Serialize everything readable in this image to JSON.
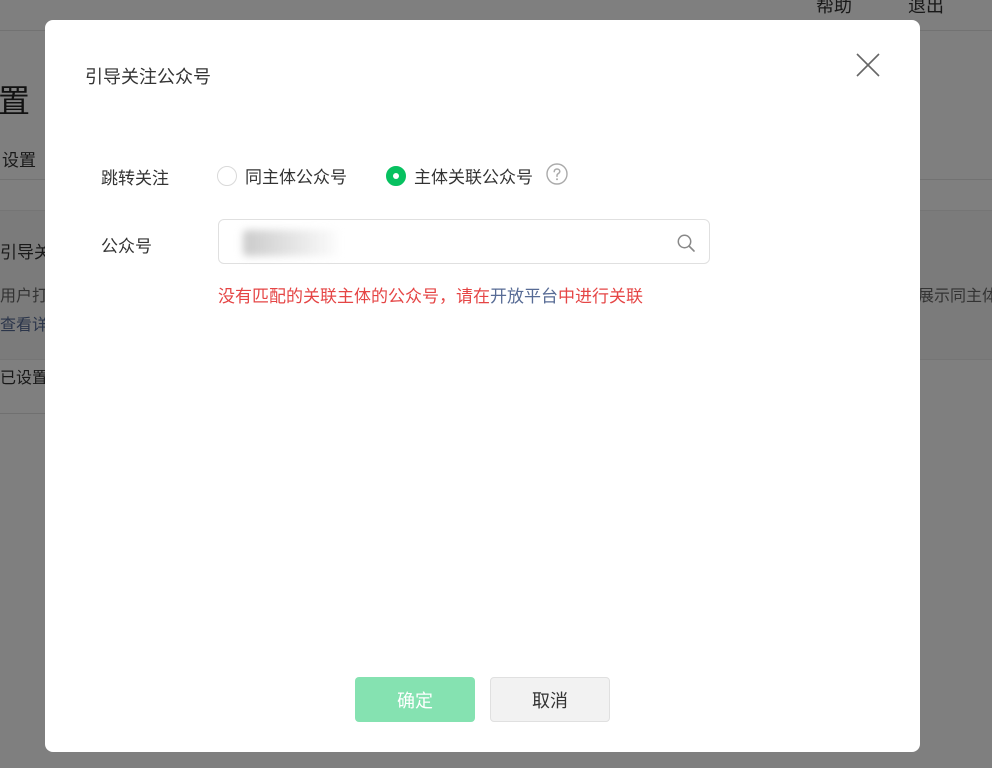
{
  "background": {
    "topbar_a": "帮助",
    "topbar_b": "退出",
    "page_title": "置",
    "tab": "设置",
    "card_title": "引导关",
    "card_desc": "用户打",
    "card_desc_right": "展示同主体",
    "card_link": "查看详",
    "setting_status": "已设置"
  },
  "dialog": {
    "title": "引导关注公众号",
    "jump_label": "跳转关注",
    "radios": [
      {
        "label": "同主体公众号",
        "checked": false
      },
      {
        "label": "主体关联公众号",
        "checked": true
      }
    ],
    "account_label": "公众号",
    "search": {
      "value": "",
      "placeholder": ""
    },
    "error": {
      "before": "没有匹配的关联主体的公众号，请在",
      "link": "开放平台",
      "after": "中进行关联"
    },
    "confirm_label": "确定",
    "cancel_label": "取消"
  },
  "colors": {
    "accent": "#07c160",
    "confirm_disabled": "#85e2b1",
    "error": "#e54545",
    "link": "#576b95",
    "overlay": "rgba(0,0,0,0.5)"
  },
  "icons": {
    "close": "close-icon",
    "help": "question-circle-icon",
    "search": "search-icon"
  }
}
